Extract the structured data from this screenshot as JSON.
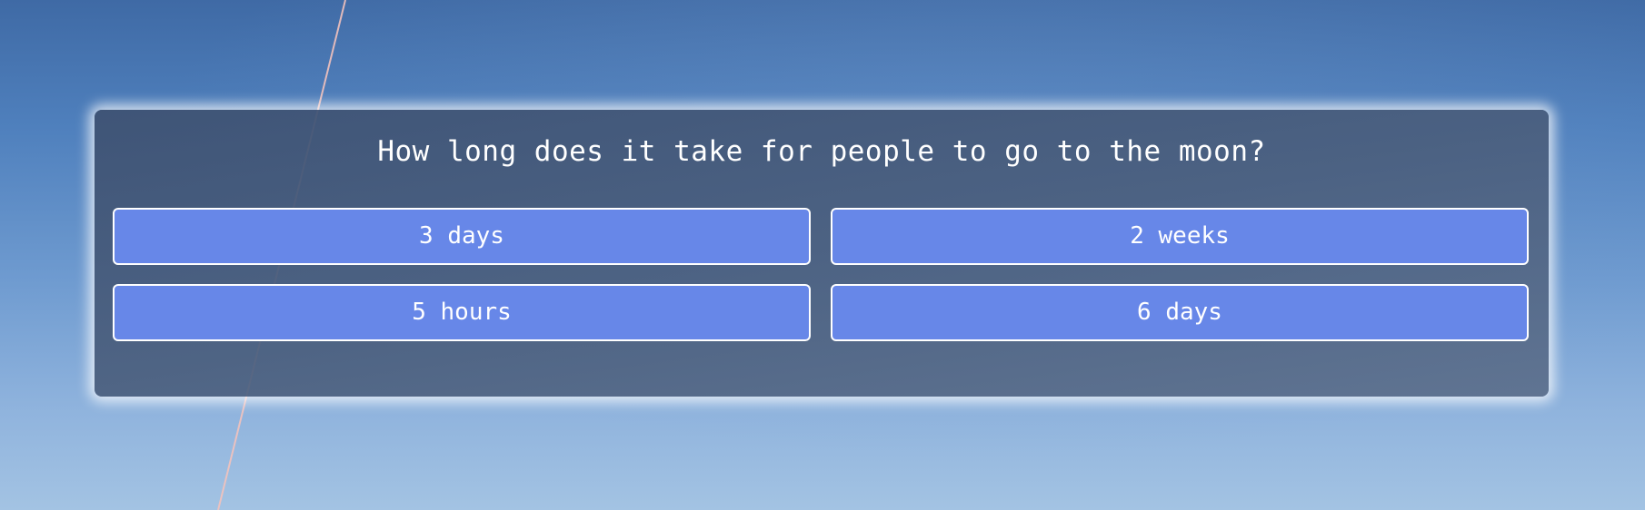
{
  "background": {
    "description_colors": {
      "sky_top": "#3f6aa5",
      "sky_bottom": "#a3c3e3",
      "trail": "#f0b9b4"
    }
  },
  "quiz": {
    "question": "How long does it take for people to go to the moon?",
    "answers": [
      {
        "label": "3 days"
      },
      {
        "label": "2 weeks"
      },
      {
        "label": "5 hours"
      },
      {
        "label": "6 days"
      }
    ]
  },
  "colors": {
    "card_bg": "#4a5e7d",
    "answer_bg": "#6787e8",
    "answer_border": "#ffffff",
    "text": "#ffffff"
  }
}
